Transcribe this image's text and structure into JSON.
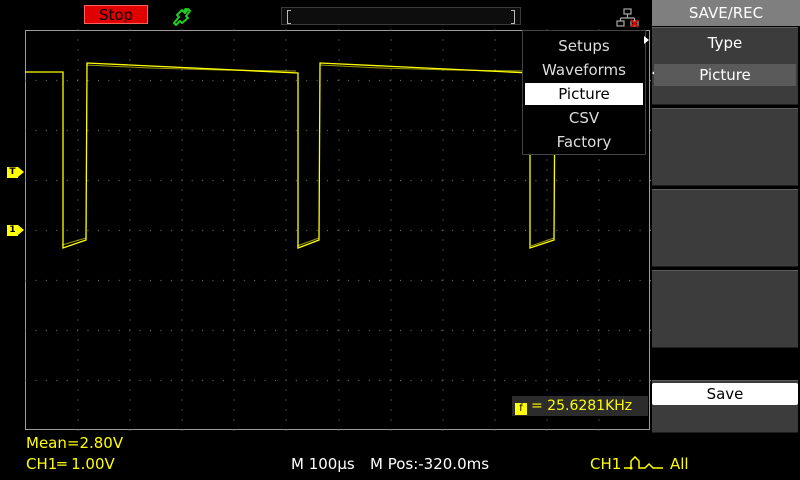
{
  "top_bar": {
    "run_status": "Stop",
    "trigger_icon": "trigger-hand-icon",
    "network_icon": "usb-network-icon"
  },
  "channel_markers": {
    "trigger_level": "T",
    "ch1_ground": "1"
  },
  "save_type_menu": {
    "items": [
      {
        "label": "Setups",
        "selected": false
      },
      {
        "label": "Waveforms",
        "selected": false
      },
      {
        "label": "Picture",
        "selected": true
      },
      {
        "label": "CSV",
        "selected": false
      },
      {
        "label": "Factory",
        "selected": false
      }
    ]
  },
  "frequency_readout": {
    "icon_glyph": "f",
    "text": "= 25.6281KHz"
  },
  "side_menu": {
    "title": "SAVE/REC",
    "type_label": "Type",
    "type_value": "Picture",
    "save_label": "Save"
  },
  "status_bar": {
    "mean": "Mean=2.80V",
    "ch1_scale": "CH1═ 1.00V",
    "timebase": "M 100µs",
    "mpos": "M Pos:-320.0ms",
    "trigger_channel": "CH1",
    "trigger_mode": "All"
  },
  "colors": {
    "ch1_trace": "#ffff00",
    "run_status_bg": "#e00000",
    "menu_title_bg": "#7f7f7f",
    "softkey_bg": "#3c3c3c"
  }
}
